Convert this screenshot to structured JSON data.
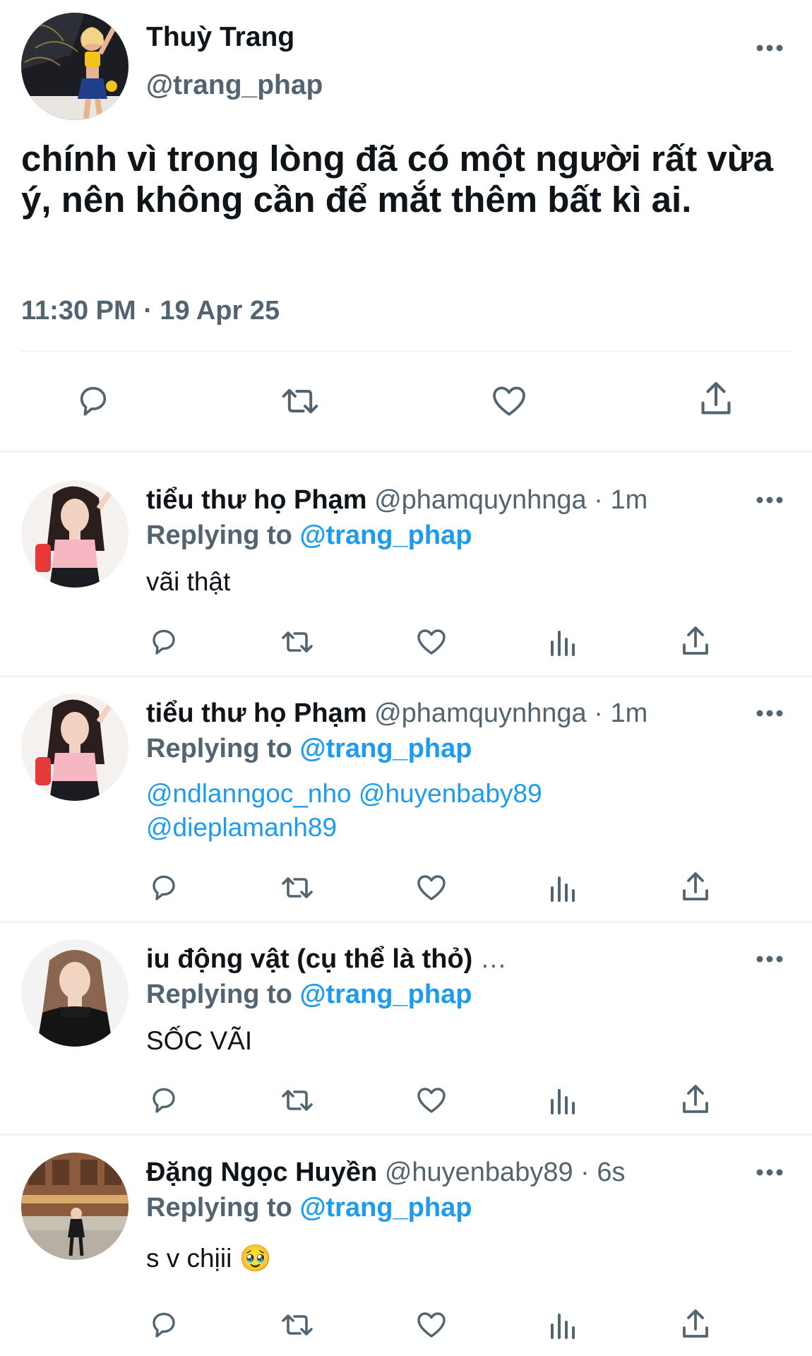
{
  "main_tweet": {
    "display_name": "Thuỳ Trang",
    "handle": "@trang_phap",
    "text": "chính vì trong lòng đã có một người rất vừa ý, nên không cần để mắt thêm bất kì ai.",
    "timestamp": "11:30 PM · 19 Apr 25"
  },
  "replies": [
    {
      "display_name": "tiểu thư họ Phạm",
      "handle": "@phamquynhnga",
      "time": " · 1m",
      "replying_prefix": "Replying to ",
      "replying_handle": "@trang_phap",
      "text": "vãi thật"
    },
    {
      "display_name": "tiểu thư họ Phạm",
      "handle": "@phamquynhnga",
      "time": " · 1m",
      "replying_prefix": "Replying to ",
      "replying_handle": "@trang_phap",
      "mentions_line1": "@ndlanngoc_nho @huyenbaby89",
      "mentions_line2": "@dieplamanh89"
    },
    {
      "display_name": "iu động vật (cụ thể là thỏ)",
      "handle": "…",
      "time": "",
      "replying_prefix": "Replying to ",
      "replying_handle": "@trang_phap",
      "text": "SỐC VÃI"
    },
    {
      "display_name": "Đặng Ngọc Huyền",
      "handle": "@huyenbaby89",
      "time": " · 6s",
      "replying_prefix": "Replying to ",
      "replying_handle": "@trang_phap",
      "text": "s v chịii",
      "emoji": "🥹"
    }
  ],
  "icons": {
    "reply": "reply-icon",
    "retweet": "retweet-icon",
    "like": "like-icon",
    "analytics": "analytics-icon",
    "share": "share-icon",
    "more": "more-dots-icon"
  },
  "colors": {
    "link": "#1d9bf0",
    "secondary": "#536471",
    "text": "#0f1419",
    "icon": "#536471"
  }
}
